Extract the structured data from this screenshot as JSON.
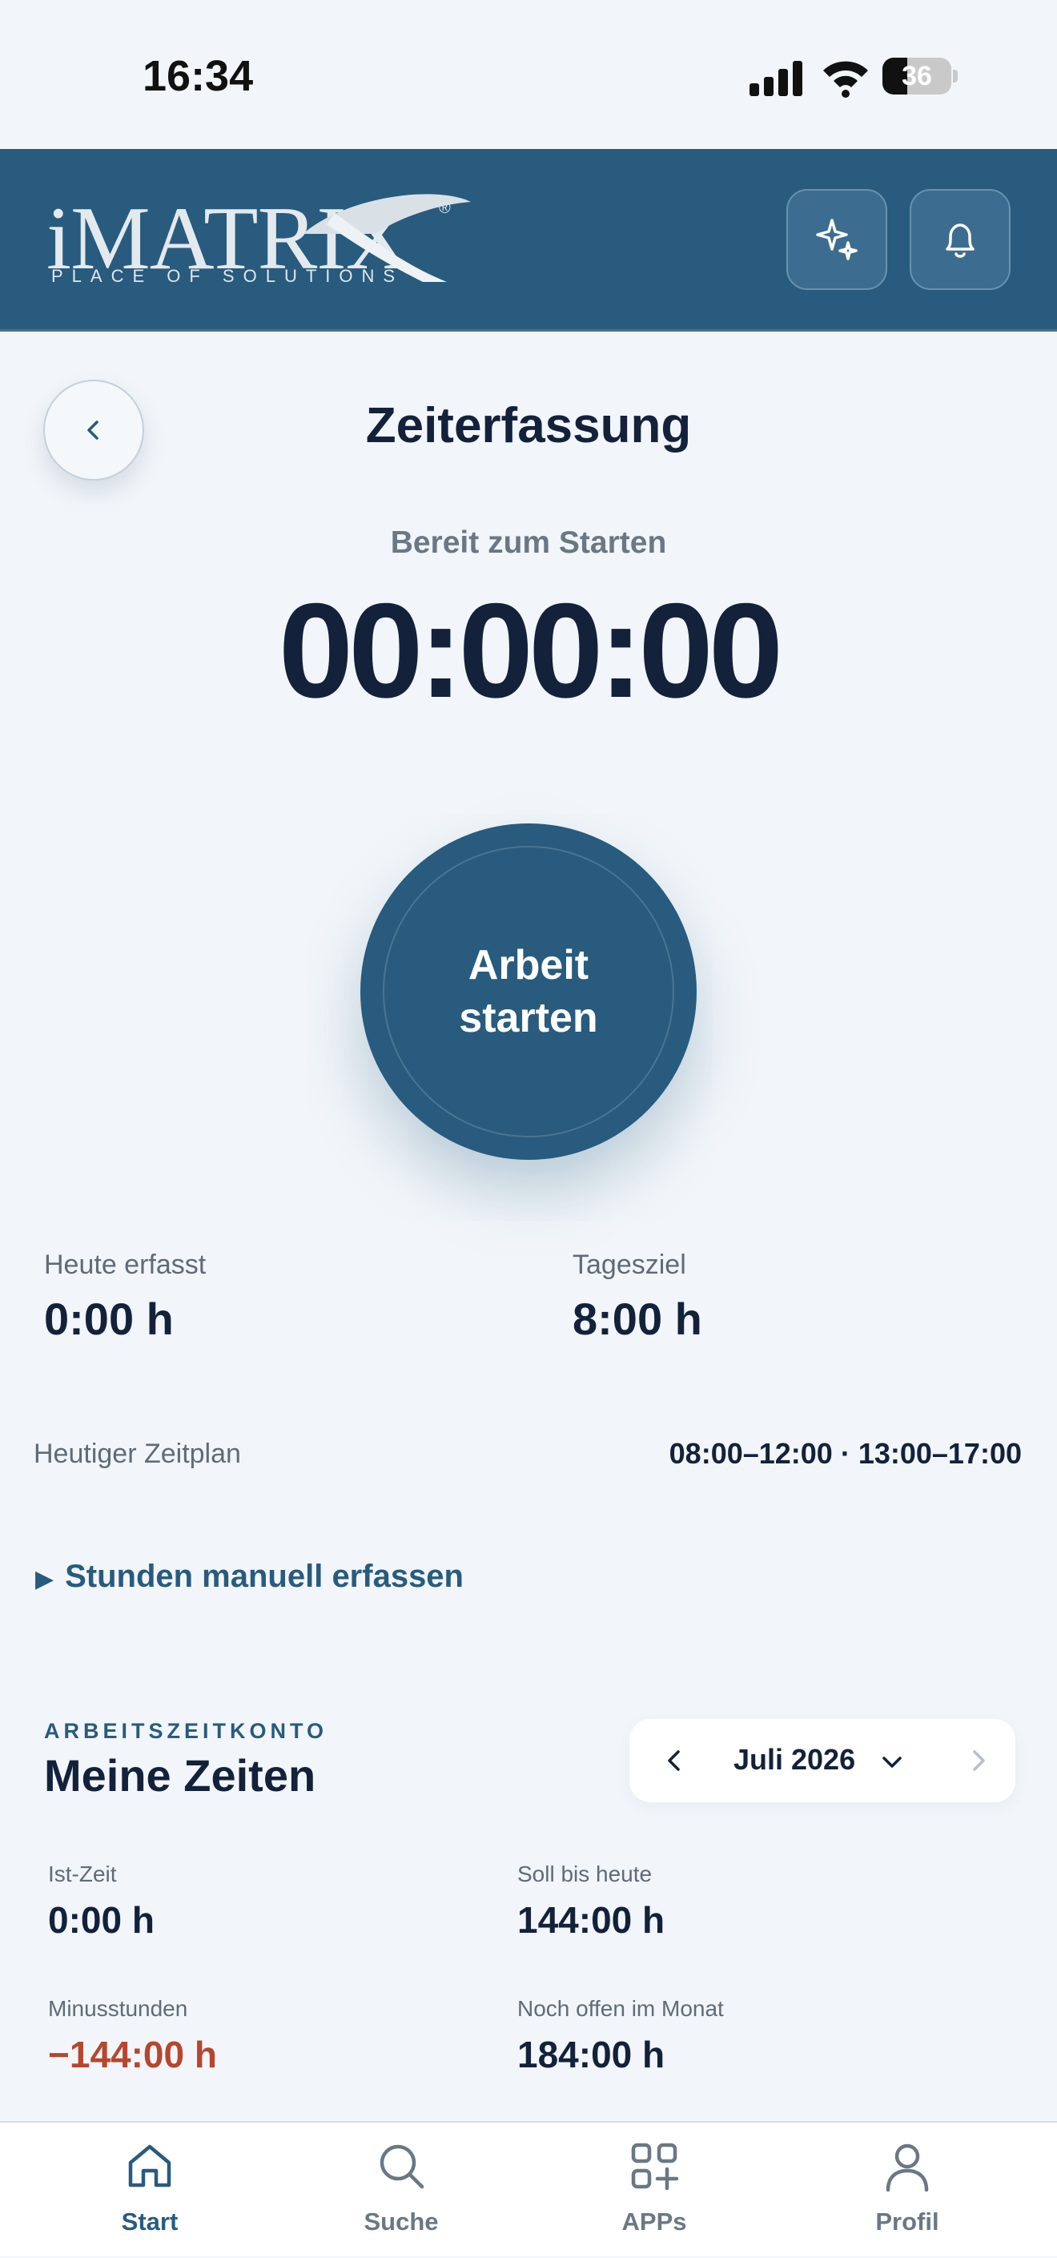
{
  "status_bar": {
    "time": "16:34",
    "battery_percent": 36,
    "battery_label": "36"
  },
  "header": {
    "logo_text": "iMATRIX",
    "logo_tagline": "PLACE OF SOLUTIONS",
    "logo_mark": "®",
    "brand_color": "#285b7e"
  },
  "page": {
    "title": "Zeiterfassung"
  },
  "timer": {
    "status": "Bereit zum Starten",
    "display": "00:00:00",
    "start_label": "Arbeit starten"
  },
  "today": {
    "recorded_label": "Heute erfasst",
    "recorded_value": "0:00 h",
    "goal_label": "Tagesziel",
    "goal_value": "8:00 h"
  },
  "schedule": {
    "label": "Heutiger Zeitplan",
    "value": "08:00–12:00 · 13:00–17:00"
  },
  "manual_entry": {
    "arrow": "▶",
    "label": "Stunden manuell erfassen"
  },
  "account": {
    "eyebrow": "ARBEITSZEITKONTO",
    "title": "Meine Zeiten",
    "month": "Juli 2026",
    "items": [
      {
        "label": "Ist-Zeit",
        "value": "0:00 h"
      },
      {
        "label": "Soll bis heute",
        "value": "144:00 h"
      },
      {
        "label": "Minusstunden",
        "value": "−144:00 h"
      },
      {
        "label": "Noch offen im Monat",
        "value": "184:00 h"
      }
    ],
    "negative_color": "#b7462f"
  },
  "tabbar": {
    "tabs": [
      {
        "label": "Start",
        "icon": "home-icon",
        "active": true
      },
      {
        "label": "Suche",
        "icon": "search-icon",
        "active": false
      },
      {
        "label": "APPs",
        "icon": "apps-grid-icon",
        "active": false
      },
      {
        "label": "Profil",
        "icon": "user-icon",
        "active": false
      }
    ]
  }
}
